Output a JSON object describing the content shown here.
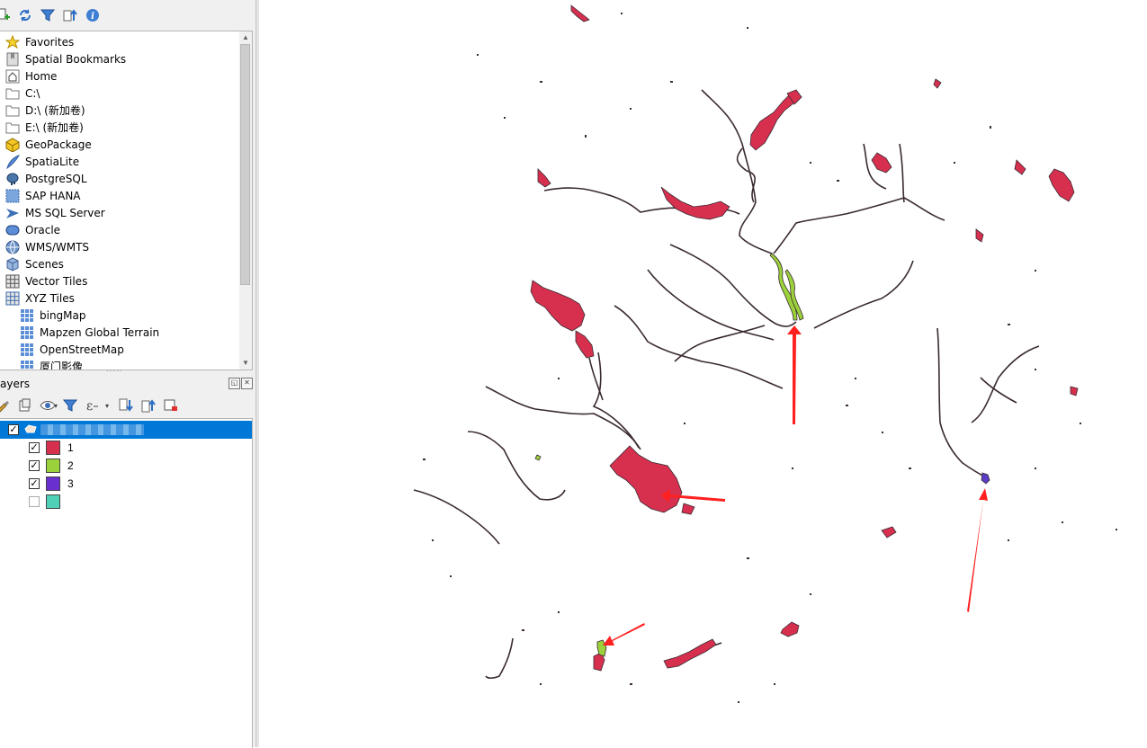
{
  "browser": {
    "toolbar": [
      {
        "name": "add-selected-layers-icon",
        "glyph": "+"
      },
      {
        "name": "refresh-icon",
        "glyph": "⟳"
      },
      {
        "name": "filter-browser-icon",
        "glyph": "▼"
      },
      {
        "name": "collapse-all-icon",
        "glyph": "⇈"
      },
      {
        "name": "properties-info-icon",
        "glyph": "i"
      }
    ],
    "items": [
      {
        "label": "Favorites",
        "icon": "star-icon"
      },
      {
        "label": "Spatial Bookmarks",
        "icon": "bookmark-icon"
      },
      {
        "label": "Home",
        "icon": "home-icon"
      },
      {
        "label": "C:\\",
        "icon": "folder-icon"
      },
      {
        "label": "D:\\ (新加卷)",
        "icon": "folder-icon"
      },
      {
        "label": "E:\\ (新加卷)",
        "icon": "folder-icon"
      },
      {
        "label": "GeoPackage",
        "icon": "geopackage-icon"
      },
      {
        "label": "SpatiaLite",
        "icon": "spatialite-feather-icon"
      },
      {
        "label": "PostgreSQL",
        "icon": "postgresql-elephant-icon"
      },
      {
        "label": "SAP HANA",
        "icon": "sap-hana-icon"
      },
      {
        "label": "MS SQL Server",
        "icon": "mssql-icon"
      },
      {
        "label": "Oracle",
        "icon": "oracle-icon"
      },
      {
        "label": "WMS/WMTS",
        "icon": "globe-icon"
      },
      {
        "label": "Scenes",
        "icon": "cube-icon"
      },
      {
        "label": "Vector Tiles",
        "icon": "grid-icon"
      },
      {
        "label": "XYZ Tiles",
        "icon": "grid-icon"
      },
      {
        "label": "bingMap",
        "icon": "tile-grid-icon",
        "child": true
      },
      {
        "label": "Mapzen Global Terrain",
        "icon": "tile-grid-icon",
        "child": true
      },
      {
        "label": "OpenStreetMap",
        "icon": "tile-grid-icon",
        "child": true
      },
      {
        "label": "厦门影像",
        "icon": "tile-grid-icon",
        "child": true
      }
    ]
  },
  "layers_panel": {
    "title": "ayers",
    "toolbar": [
      {
        "name": "style-brush-icon",
        "glyph": "✎"
      },
      {
        "name": "add-group-icon",
        "glyph": "⊞"
      },
      {
        "name": "visibility-eye-icon",
        "glyph": "◉"
      },
      {
        "name": "filter-legend-icon",
        "glyph": "▼"
      },
      {
        "name": "filter-expression-icon",
        "glyph": "ε"
      },
      {
        "name": "expand-all-icon",
        "glyph": "⇊"
      },
      {
        "name": "collapse-all-icon",
        "glyph": "⇈"
      },
      {
        "name": "remove-layer-icon",
        "glyph": "▭"
      }
    ],
    "layer": {
      "name": "",
      "checked": true
    },
    "categories": [
      {
        "label": "1",
        "color": "#d7304f",
        "checked": true
      },
      {
        "label": "2",
        "color": "#9bd13a",
        "checked": true
      },
      {
        "label": "3",
        "color": "#6a2fcf",
        "checked": true
      },
      {
        "label": "",
        "color": "#4fd1b8",
        "checked": false
      }
    ]
  },
  "map": {
    "polygon_fill": "#d7304f",
    "highlight_fill": "#9bd13a",
    "category3_fill": "#5b3cc4",
    "line_color": "#3a2a32",
    "arrow_color": "#ff2020"
  }
}
